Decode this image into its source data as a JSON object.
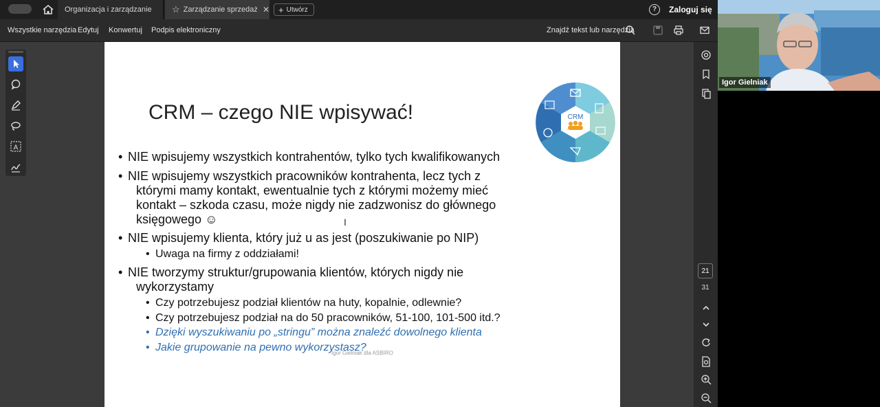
{
  "tabs": [
    {
      "label": "Organizacja i zarządzanie sprz..."
    },
    {
      "label": "Zarządzanie sprzedażą..."
    }
  ],
  "new_button": "Utwórz",
  "sign_in": "Zaloguj się",
  "menu": {
    "all_tools": "Wszystkie narzędzia",
    "edit": "Edytuj",
    "convert": "Konwertuj",
    "esign": "Podpis elektroniczny",
    "find": "Znajdź tekst lub narzędzia"
  },
  "slide": {
    "title": "CRM – czego NIE wpisywać!",
    "bullets": [
      "NIE wpisujemy wszystkich kontrahentów, tylko tych kwalifikowanych",
      "NIE wpisujemy wszystkich pracowników kontrahenta, lecz tych z",
      "którymi mamy kontakt, ewentualnie tych z którymi możemy mieć",
      "kontakt – szkoda czasu, może nigdy nie zadzwonisz do głównego",
      "księgowego ☺",
      "NIE wpisujemy klienta, który już u as jest (poszukiwanie po NIP)",
      "Uwaga na firmy z oddziałami!",
      "NIE tworzymy struktur/grupowania klientów, których nigdy nie",
      "wykorzystamy",
      "Czy potrzebujesz podział klientów na huty, kopalnie, odlewnie?",
      "Czy potrzebujesz podział na do 50 pracowników, 51-100, 101-500 itd.?",
      "Dzięki wyszukiwaniu po „stringu” można znaleźć dowolnego klienta",
      "Jakie grupowanie na pewno wykorzystasz?"
    ],
    "footer": "Igor Gielniak dla ASBIRO",
    "crm_label": "CRM"
  },
  "page": {
    "current": "21",
    "total": "31"
  },
  "video": {
    "name": "Igor Gielniak"
  },
  "colors": {
    "accent": "#3a6fe0",
    "link_blue": "#2f6fb1"
  }
}
